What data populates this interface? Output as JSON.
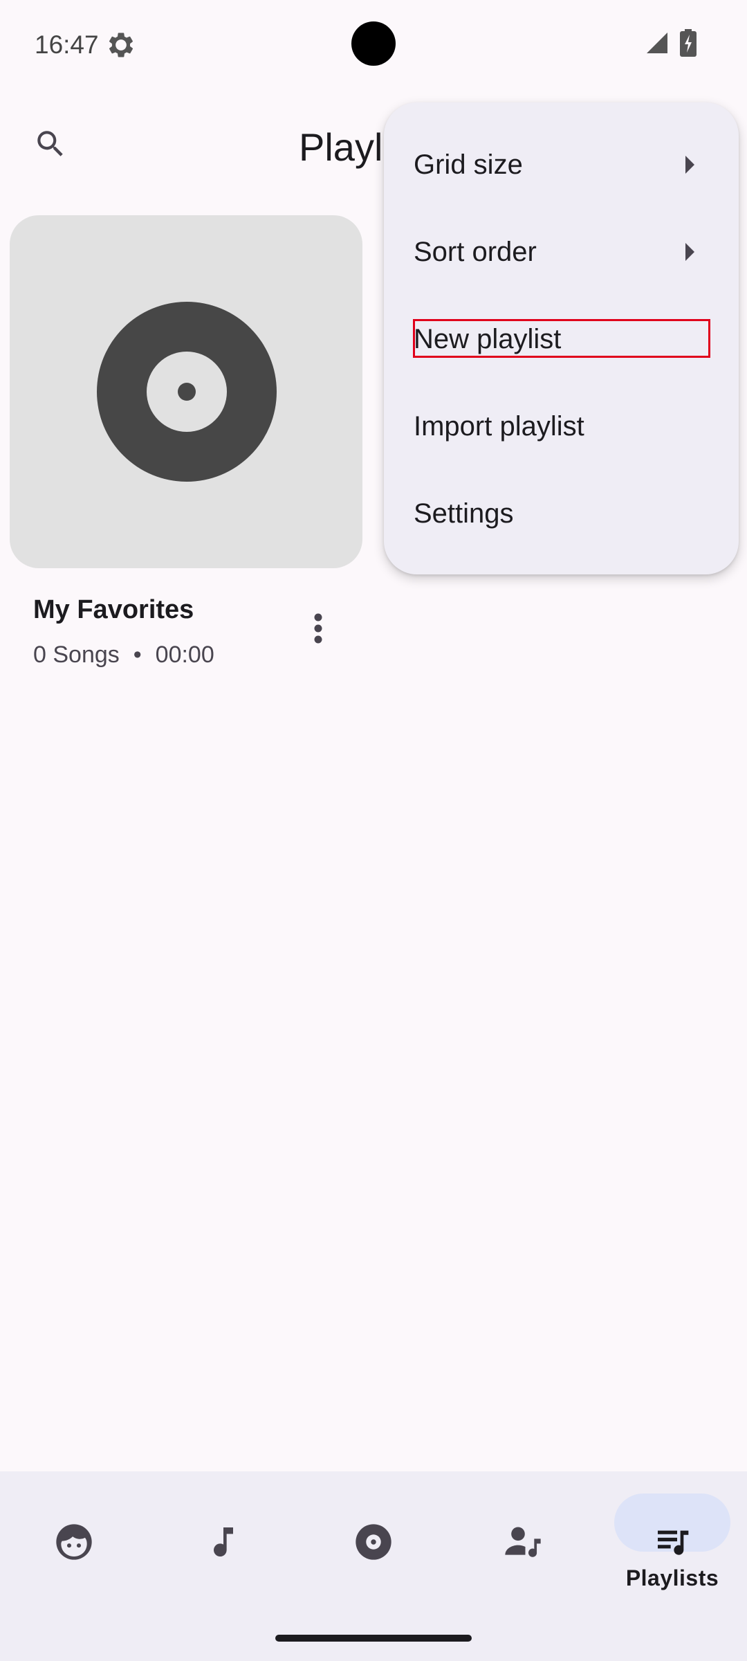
{
  "status_bar": {
    "time": "16:47"
  },
  "header": {
    "title": "Playlists"
  },
  "playlists": [
    {
      "name": "My Favorites",
      "songs": "0 Songs",
      "separator": "•",
      "duration": "00:00"
    }
  ],
  "menu": {
    "items": [
      {
        "label": "Grid size",
        "has_submenu": true
      },
      {
        "label": "Sort order",
        "has_submenu": true
      },
      {
        "label": "New playlist",
        "has_submenu": false,
        "highlighted": true
      },
      {
        "label": "Import playlist",
        "has_submenu": false
      },
      {
        "label": "Settings",
        "has_submenu": false
      }
    ]
  },
  "bottom_nav": {
    "items": [
      {
        "icon": "for-you-face-icon"
      },
      {
        "icon": "music-note-icon"
      },
      {
        "icon": "album-disc-icon"
      },
      {
        "icon": "artist-icon"
      },
      {
        "icon": "playlist-icon",
        "label": "Playlists",
        "selected": true
      }
    ]
  },
  "colors": {
    "background": "#fcf8fb",
    "menu_surface": "#efedf5",
    "nav_indicator": "#dde3f8",
    "highlight_outline": "#e0001b",
    "icon": "#49454f"
  }
}
